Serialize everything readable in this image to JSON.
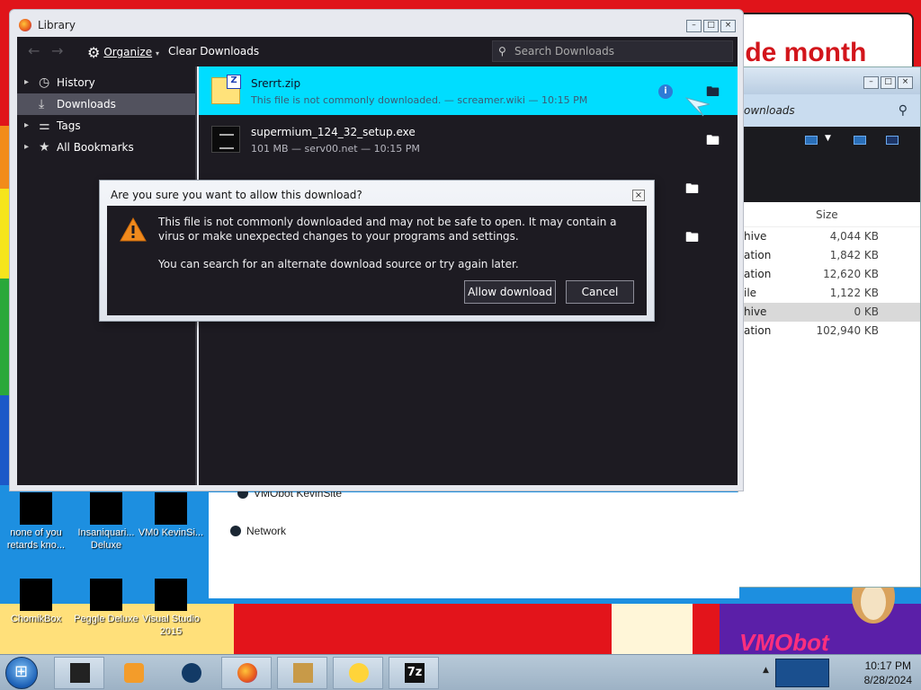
{
  "banner": {
    "text": "ide month"
  },
  "watermark": {
    "text": "VMObot"
  },
  "desktop_icons": [
    {
      "label": "none of you retards kno..."
    },
    {
      "label": "Insaniquari... Deluxe"
    },
    {
      "label": "VM0 KevinSi..."
    },
    {
      "label": "ChomikBox"
    },
    {
      "label": "Peggle Deluxe"
    },
    {
      "label": "Visual Studio 2015"
    }
  ],
  "explorer": {
    "address_text": "ownloads",
    "size_header": "Size",
    "rows": [
      {
        "type": "hive",
        "size": "4,044 KB"
      },
      {
        "type": "ation",
        "size": "1,842 KB"
      },
      {
        "type": "ation",
        "size": "12,620 KB"
      },
      {
        "type": "ile",
        "size": "1,122 KB"
      },
      {
        "type": "hive",
        "size": "0 KB"
      },
      {
        "type": "ation",
        "size": "102,940 KB"
      }
    ],
    "lower_items": [
      {
        "label": "VMObot KevinSite"
      },
      {
        "label": "Network"
      }
    ]
  },
  "library": {
    "title": "Library",
    "toolbar": {
      "organize": "Organize",
      "clear_downloads": "Clear Downloads",
      "search_placeholder": "Search Downloads"
    },
    "sidebar": [
      {
        "label": "History",
        "icon": "clock-icon"
      },
      {
        "label": "Downloads",
        "icon": "download-icon"
      },
      {
        "label": "Tags",
        "icon": "tag-icon"
      },
      {
        "label": "All Bookmarks",
        "icon": "star-icon"
      }
    ],
    "downloads": [
      {
        "name": "Srerrt.zip",
        "meta": "This file is not commonly downloaded. — screamer.wiki — 10:15 PM"
      },
      {
        "name": "supermium_124_32_setup.exe",
        "meta": "101 MB — serv00.net — 10:15 PM"
      }
    ]
  },
  "dialog": {
    "title": "Are you sure you want to allow this download?",
    "message": "This file is not commonly downloaded and may not be safe to open. It may contain a virus or make unexpected changes to your programs and settings.",
    "message2": "You can search for an alternate download source or try again later.",
    "allow_label": "Allow download",
    "cancel_label": "Cancel"
  },
  "taskbar": {
    "time": "10:17 PM",
    "date": "8/28/2024"
  },
  "colors": {
    "accent_selected": "#00ddff",
    "dark_bg": "#1d1b22",
    "warning": "#f08a1d"
  }
}
